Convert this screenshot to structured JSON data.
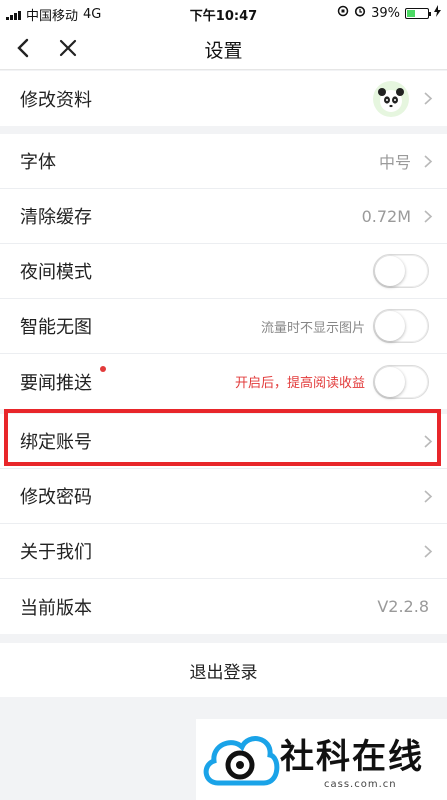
{
  "status_bar": {
    "carrier": "中国移动",
    "network": "4G",
    "time": "下午10:47",
    "battery_percent": "39%",
    "battery_level": 0.39
  },
  "nav": {
    "title": "设置",
    "back_icon": "chevron-left-icon",
    "close_icon": "close-icon"
  },
  "profile": {
    "label": "修改资料",
    "avatar_icon": "panda-avatar"
  },
  "settings": {
    "font": {
      "label": "字体",
      "value": "中号"
    },
    "cache": {
      "label": "清除缓存",
      "value": "0.72M"
    },
    "night_mode": {
      "label": "夜间模式",
      "enabled": false
    },
    "no_image": {
      "label": "智能无图",
      "note": "流量时不显示图片",
      "enabled": false
    },
    "push": {
      "label": "要闻推送",
      "note": "开启后，提高阅读收益",
      "enabled": false
    }
  },
  "account": {
    "bind": {
      "label": "绑定账号"
    },
    "password": {
      "label": "修改密码"
    },
    "about": {
      "label": "关于我们"
    },
    "version": {
      "label": "当前版本",
      "value": "V2.2.8"
    }
  },
  "logout": {
    "label": "退出登录"
  },
  "watermark": {
    "brand": "社科在线",
    "domain": "cass.com.cn"
  },
  "colors": {
    "highlight": "#e8262a",
    "red_note": "#e23b3b",
    "battery": "#4cd964",
    "background": "#f2f3f5"
  }
}
